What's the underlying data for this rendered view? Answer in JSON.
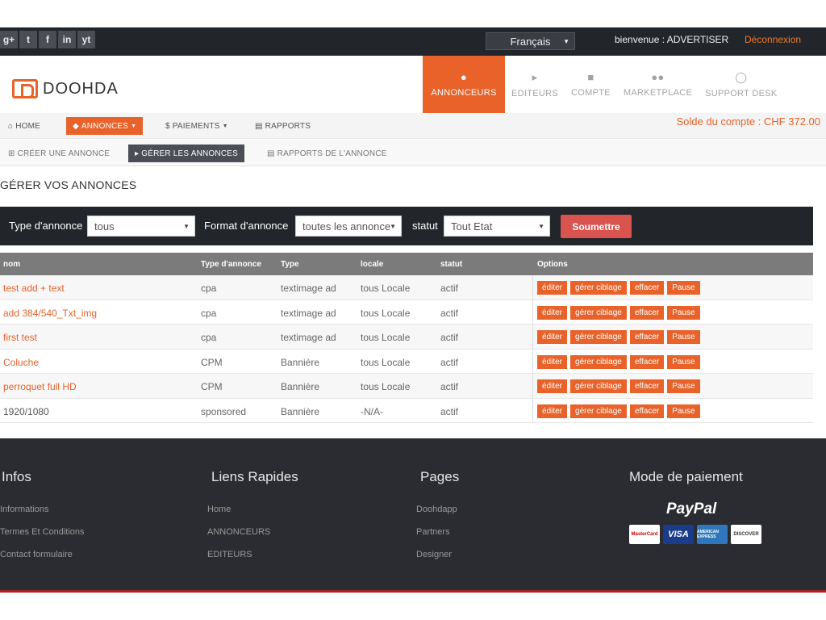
{
  "topbar": {
    "social": [
      {
        "icon": "google-plus-icon",
        "glyph": "g+"
      },
      {
        "icon": "twitter-icon",
        "glyph": "t"
      },
      {
        "icon": "facebook-icon",
        "glyph": "f"
      },
      {
        "icon": "linkedin-icon",
        "glyph": "in"
      },
      {
        "icon": "youtube-icon",
        "glyph": "yt"
      }
    ],
    "language": "Français",
    "welcome": "bienvenue : ADVERTISER",
    "logout": "Déconnexion"
  },
  "header": {
    "logo_text": "DOOHDA",
    "nav": [
      {
        "label": "ANNONCEURS",
        "icon": "user-icon",
        "active": true
      },
      {
        "label": "EDITEURS",
        "icon": "megaphone-icon",
        "active": false
      },
      {
        "label": "COMPTE",
        "icon": "briefcase-icon",
        "active": false
      },
      {
        "label": "MARKETPLACE",
        "icon": "users-icon",
        "active": false
      },
      {
        "label": "SUPPORT DESK",
        "icon": "lifebuoy-icon",
        "active": false
      }
    ]
  },
  "subnav1": {
    "home": "HOME",
    "annonces": "ANNONCES",
    "paiements": "PAIEMENTS",
    "rapports": "RAPPORTS",
    "solde": "Solde du compte : CHF 372.00"
  },
  "subnav2": {
    "create": "CRÉER UNE ANNONCE",
    "manage": "GÉRER LES ANNONCES",
    "reports": "RAPPORTS DE L'ANNONCE"
  },
  "page_title": "GÉRER VOS ANNONCES",
  "filter": {
    "type_label": "Type d'annonce",
    "type_value": "tous",
    "format_label": "Format d'annonce",
    "format_value": "toutes les annonce",
    "status_label": "statut",
    "status_value": "Tout Etat",
    "submit": "Soumettre"
  },
  "table": {
    "headers": [
      "nom",
      "Type d'annonce",
      "Type",
      "locale",
      "statut",
      "Options"
    ],
    "option_labels": [
      "éditer",
      "gérer ciblage",
      "effacer",
      "Pause"
    ],
    "rows": [
      {
        "nom": "test add + text",
        "type_annonce": "cpa",
        "type": "textimage ad",
        "locale": "tous Locale",
        "statut": "actif"
      },
      {
        "nom": "add 384/540_Txt_img",
        "type_annonce": "cpa",
        "type": "textimage ad",
        "locale": "tous Locale",
        "statut": "actif"
      },
      {
        "nom": "first test",
        "type_annonce": "cpa",
        "type": "textimage ad",
        "locale": "tous Locale",
        "statut": "actif"
      },
      {
        "nom": "Coluche",
        "type_annonce": "CPM",
        "type": "Bannière",
        "locale": "tous Locale",
        "statut": "actif"
      },
      {
        "nom": "perroquet full HD",
        "type_annonce": "CPM",
        "type": "Bannière",
        "locale": "tous Locale",
        "statut": "actif"
      },
      {
        "nom": "1920/1080",
        "type_annonce": "sponsored",
        "type": "Bannière",
        "locale": "-N/A-",
        "statut": "actif"
      }
    ]
  },
  "footer": {
    "infos": {
      "title": "Infos",
      "links": [
        "Informations",
        "Termes Et Conditions",
        "Contact formulaire"
      ]
    },
    "liens": {
      "title": "Liens Rapides",
      "links": [
        "Home",
        "ANNONCEURS",
        "EDITEURS"
      ]
    },
    "pages": {
      "title": "Pages",
      "links": [
        "Doohdapp",
        "Partners",
        "Designer"
      ]
    },
    "paiement": {
      "title": "Mode de paiement",
      "paypal": "PayPal",
      "cards": [
        "MasterCard",
        "VISA",
        "AMERICAN EXPRESS",
        "DISCOVER"
      ]
    }
  },
  "colors": {
    "accent": "#e8622a",
    "dark": "#22252a",
    "submit": "#d9534f",
    "footer": "#2a2c31"
  }
}
